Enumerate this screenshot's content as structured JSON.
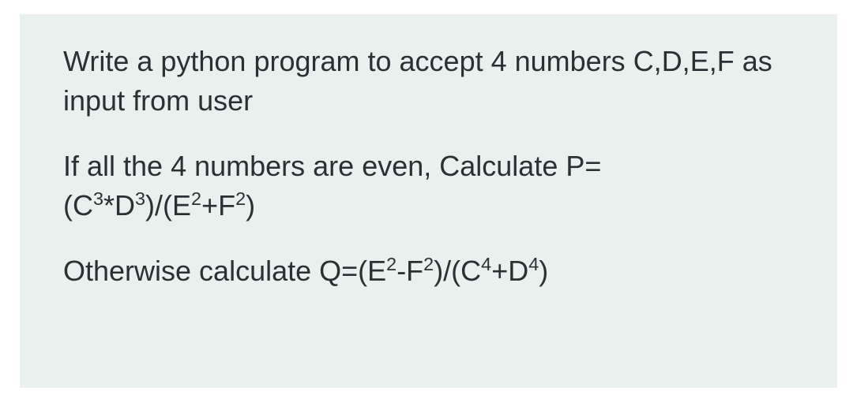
{
  "problem": {
    "p1_part1": "Write a python program to accept 4 numbers C,D,E,F as input from user",
    "p2_prefix": "If all the 4 numbers are even, Calculate P=",
    "p2_formula_parts": {
      "open": "(C",
      "e1": "3",
      "t2": "*D",
      "e2": "3",
      "t3": ")/(E",
      "e3": "2",
      "t4": "+F",
      "e4": "2",
      "close": ")"
    },
    "p3_prefix": "Otherwise calculate Q=(E",
    "p3_formula_parts": {
      "e1": "2",
      "t2": "-F",
      "e2": "2",
      "t3": ")/(C",
      "e3": "4",
      "t4": "+D",
      "e4": "4",
      "close": ")"
    }
  }
}
